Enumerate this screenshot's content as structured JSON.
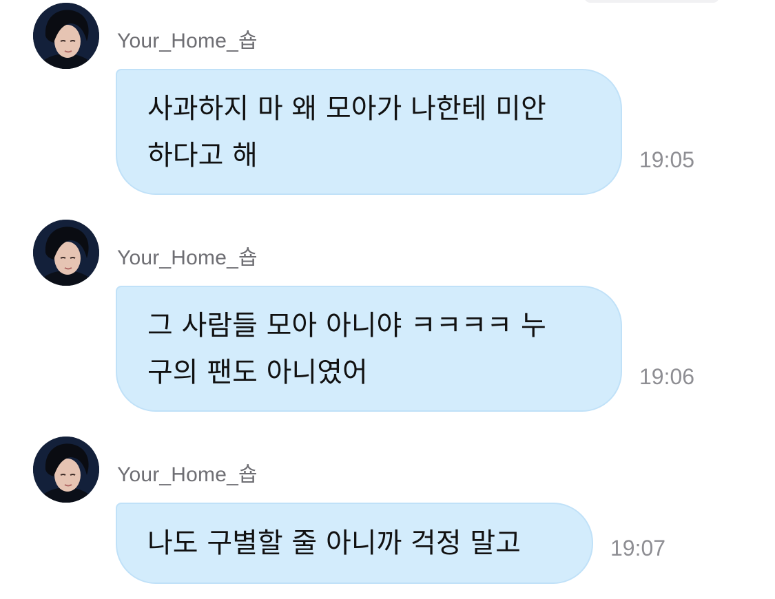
{
  "chat": {
    "messages": [
      {
        "sender": "Your_Home_숍",
        "avatar": "avatar-photo",
        "lines": [
          "사과하지 마 왜 모아가 나한테 미안",
          "하다고 해"
        ],
        "time": "19:05"
      },
      {
        "sender": "Your_Home_숍",
        "avatar": "avatar-photo",
        "lines": [
          "그 사람들 모아 아니야 ㅋㅋㅋㅋ 누",
          "구의 팬도 아니였어"
        ],
        "time": "19:06"
      },
      {
        "sender": "Your_Home_숍",
        "avatar": "avatar-photo",
        "lines": [
          "나도 구별할 줄 아니까 걱정 말고"
        ],
        "time": "19:07"
      }
    ]
  },
  "colors": {
    "bubble": "#d3ecfc",
    "bubble_border": "#c0e1f8",
    "sender_text": "#6e6e73",
    "time_text": "#8e8e93"
  }
}
